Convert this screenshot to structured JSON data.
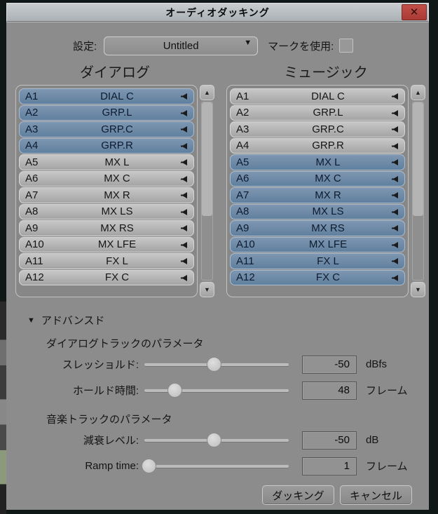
{
  "window": {
    "title": "オーディオダッキング",
    "close_glyph": "✕"
  },
  "settings": {
    "label": "設定:",
    "preset_value": "Untitled",
    "use_marks_label": "マークを使用:",
    "use_marks_checked": false
  },
  "columns": [
    {
      "id": "dialog",
      "header": "ダイアログ",
      "tracks": [
        {
          "id": "A1",
          "name": "DIAL C",
          "selected": true
        },
        {
          "id": "A2",
          "name": "GRP.L",
          "selected": true
        },
        {
          "id": "A3",
          "name": "GRP.C",
          "selected": true
        },
        {
          "id": "A4",
          "name": "GRP.R",
          "selected": true
        },
        {
          "id": "A5",
          "name": "MX L",
          "selected": false
        },
        {
          "id": "A6",
          "name": "MX C",
          "selected": false
        },
        {
          "id": "A7",
          "name": "MX R",
          "selected": false
        },
        {
          "id": "A8",
          "name": "MX LS",
          "selected": false
        },
        {
          "id": "A9",
          "name": "MX RS",
          "selected": false
        },
        {
          "id": "A10",
          "name": "MX LFE",
          "selected": false
        },
        {
          "id": "A11",
          "name": "FX L",
          "selected": false
        },
        {
          "id": "A12",
          "name": "FX C",
          "selected": false
        }
      ]
    },
    {
      "id": "music",
      "header": "ミュージック",
      "tracks": [
        {
          "id": "A1",
          "name": "DIAL C",
          "selected": false
        },
        {
          "id": "A2",
          "name": "GRP.L",
          "selected": false
        },
        {
          "id": "A3",
          "name": "GRP.C",
          "selected": false
        },
        {
          "id": "A4",
          "name": "GRP.R",
          "selected": false
        },
        {
          "id": "A5",
          "name": "MX L",
          "selected": true
        },
        {
          "id": "A6",
          "name": "MX C",
          "selected": true
        },
        {
          "id": "A7",
          "name": "MX R",
          "selected": true
        },
        {
          "id": "A8",
          "name": "MX LS",
          "selected": true
        },
        {
          "id": "A9",
          "name": "MX RS",
          "selected": true
        },
        {
          "id": "A10",
          "name": "MX LFE",
          "selected": true
        },
        {
          "id": "A11",
          "name": "FX L",
          "selected": true
        },
        {
          "id": "A12",
          "name": "FX C",
          "selected": true
        }
      ]
    }
  ],
  "advanced": {
    "toggle_glyph": "▼",
    "toggle_label": "アドバンスド",
    "groups": [
      {
        "label": "ダイアログトラックのパラメータ",
        "params": [
          {
            "key": "threshold",
            "label": "スレッショルド:",
            "value": "-50",
            "unit": "dBfs",
            "slider_percent": 48
          },
          {
            "key": "hold-time",
            "label": "ホールド時間:",
            "value": "48",
            "unit": "フレーム",
            "slider_percent": 21
          }
        ]
      },
      {
        "label": "音楽トラックのパラメータ",
        "params": [
          {
            "key": "attenuation-level",
            "label": "減衰レベル:",
            "value": "-50",
            "unit": "dB",
            "slider_percent": 48
          },
          {
            "key": "ramp-time",
            "label": "Ramp time:",
            "value": "1",
            "unit": "フレーム",
            "slider_percent": 3
          }
        ]
      }
    ]
  },
  "footer": {
    "duck_label": "ダッキング",
    "cancel_label": "キャンセル"
  },
  "colors": {
    "dialog_bg": "#8c8c8c",
    "selected_row": "#6f89a6",
    "unselected_row": "#b5b5b5",
    "titlebar": "#b9bdc1",
    "close_red": "#b5453e"
  }
}
